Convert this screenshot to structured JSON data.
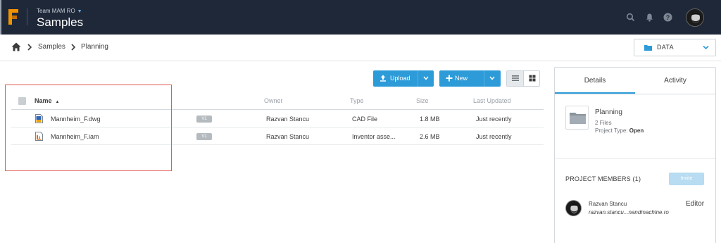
{
  "header": {
    "team": "Team MAM RO",
    "title": "Samples",
    "icons": [
      "search-icon",
      "bell-icon",
      "help-icon"
    ],
    "colors": {
      "bar": "#1f2838",
      "logo": "#f39200",
      "accent": "#2d9bd8"
    }
  },
  "breadcrumb": {
    "items": [
      "Samples",
      "Planning"
    ],
    "data_button": "DATA"
  },
  "toolbar": {
    "upload": "Upload",
    "new": "New"
  },
  "table": {
    "columns": [
      "Name",
      "Owner",
      "Type",
      "Size",
      "Last Updated"
    ],
    "rows": [
      {
        "name": "Mannheim_F.dwg",
        "version": "V1",
        "owner": "Razvan Stancu",
        "type": "CAD File",
        "size": "1.8 MB",
        "updated": "Just recently",
        "icon": "dwg-file-icon"
      },
      {
        "name": "Mannheim_F.iam",
        "version": "V1",
        "owner": "Razvan Stancu",
        "type": "Inventor asse...",
        "size": "2.6 MB",
        "updated": "Just recently",
        "icon": "iam-file-icon"
      }
    ]
  },
  "panel": {
    "tabs": [
      "Details",
      "Activity"
    ],
    "project": {
      "name": "Planning",
      "files": "2 Files",
      "type_label": "Project Type:",
      "type_value": "Open"
    },
    "members_title": "PROJECT MEMBERS (1)",
    "invite": "Invite",
    "member": {
      "name": "Razvan Stancu",
      "email": "razvan.stancu...nandmachine.ro",
      "role": "Editor"
    }
  }
}
